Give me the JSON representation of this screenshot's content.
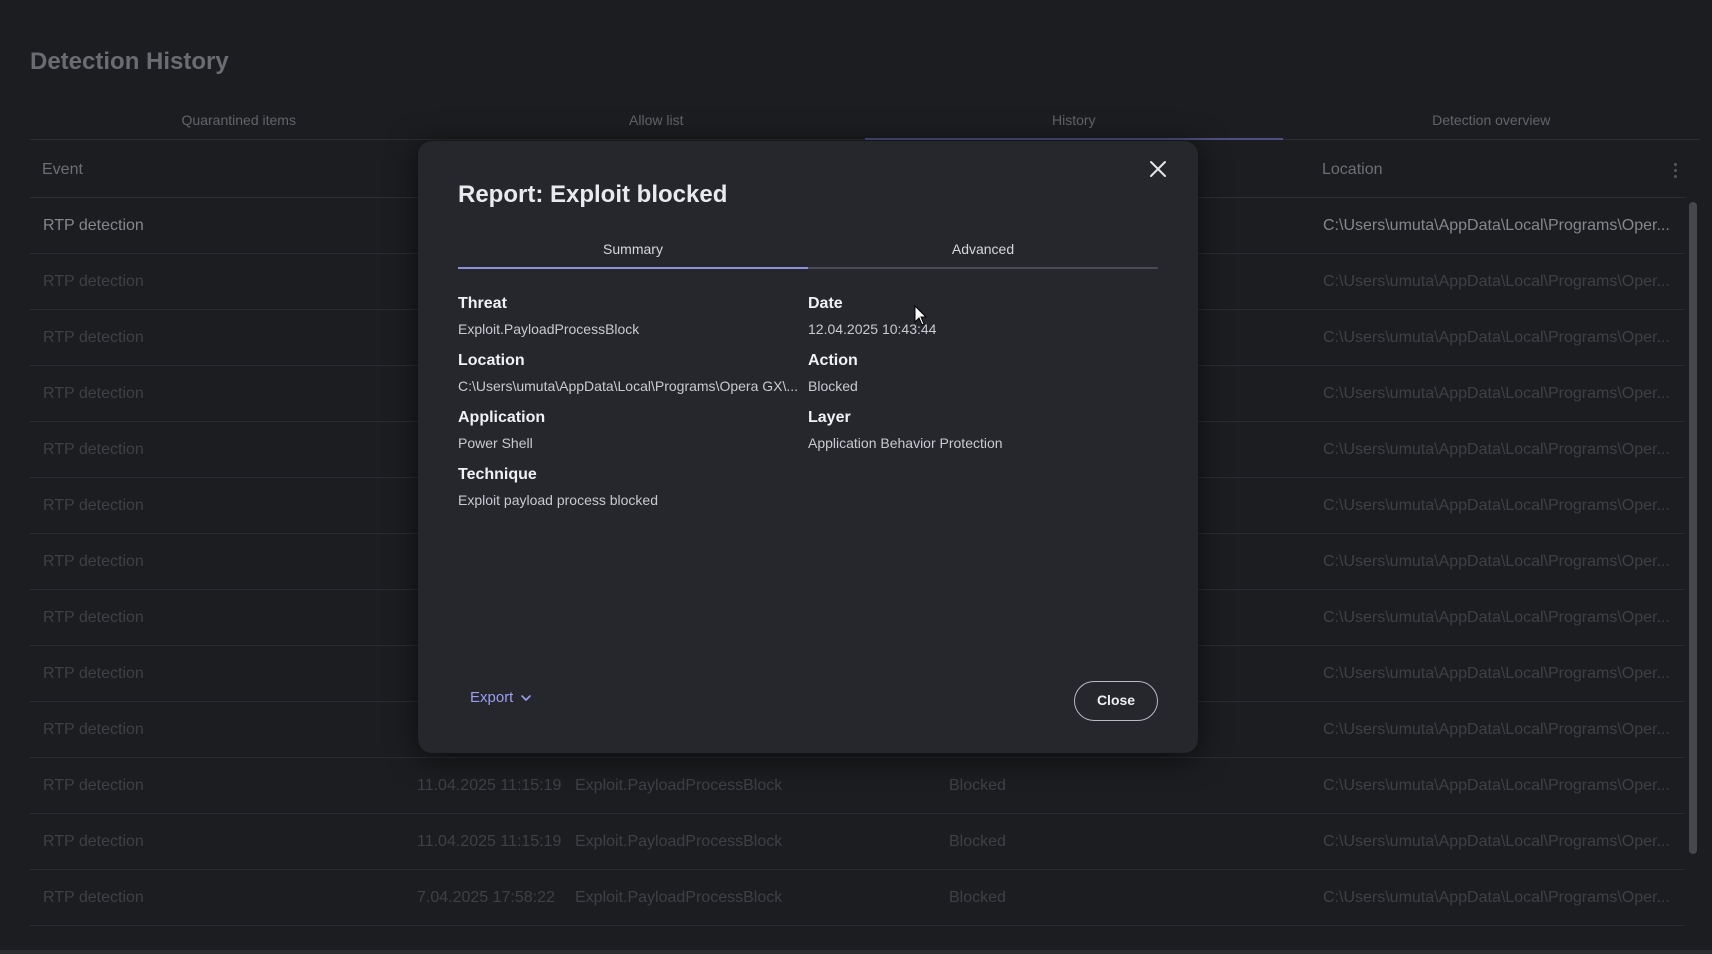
{
  "page": {
    "title": "Detection History",
    "tabs": [
      "Quarantined items",
      "Allow list",
      "History",
      "Detection overview"
    ],
    "active_tab": 2
  },
  "table": {
    "columns": {
      "event": "Event",
      "location": "Location"
    },
    "rows": [
      {
        "event": "RTP detection",
        "date": "",
        "threat": "",
        "action": "",
        "location": "C:\\Users\\umuta\\AppData\\Local\\Programs\\Oper..."
      },
      {
        "event": "RTP detection",
        "date": "",
        "threat": "",
        "action": "",
        "location": "C:\\Users\\umuta\\AppData\\Local\\Programs\\Oper..."
      },
      {
        "event": "RTP detection",
        "date": "",
        "threat": "",
        "action": "",
        "location": "C:\\Users\\umuta\\AppData\\Local\\Programs\\Oper..."
      },
      {
        "event": "RTP detection",
        "date": "",
        "threat": "",
        "action": "",
        "location": "C:\\Users\\umuta\\AppData\\Local\\Programs\\Oper..."
      },
      {
        "event": "RTP detection",
        "date": "",
        "threat": "",
        "action": "",
        "location": "C:\\Users\\umuta\\AppData\\Local\\Programs\\Oper..."
      },
      {
        "event": "RTP detection",
        "date": "",
        "threat": "",
        "action": "",
        "location": "C:\\Users\\umuta\\AppData\\Local\\Programs\\Oper..."
      },
      {
        "event": "RTP detection",
        "date": "",
        "threat": "",
        "action": "",
        "location": "C:\\Users\\umuta\\AppData\\Local\\Programs\\Oper..."
      },
      {
        "event": "RTP detection",
        "date": "",
        "threat": "",
        "action": "",
        "location": "C:\\Users\\umuta\\AppData\\Local\\Programs\\Oper..."
      },
      {
        "event": "RTP detection",
        "date": "",
        "threat": "",
        "action": "",
        "location": "C:\\Users\\umuta\\AppData\\Local\\Programs\\Oper..."
      },
      {
        "event": "RTP detection",
        "date": "",
        "threat": "",
        "action": "",
        "location": "C:\\Users\\umuta\\AppData\\Local\\Programs\\Oper..."
      },
      {
        "event": "RTP detection",
        "date": "11.04.2025 11:15:19",
        "threat": "Exploit.PayloadProcessBlock",
        "action": "Blocked",
        "location": "C:\\Users\\umuta\\AppData\\Local\\Programs\\Oper..."
      },
      {
        "event": "RTP detection",
        "date": "11.04.2025 11:15:19",
        "threat": "Exploit.PayloadProcessBlock",
        "action": "Blocked",
        "location": "C:\\Users\\umuta\\AppData\\Local\\Programs\\Oper..."
      },
      {
        "event": "RTP detection",
        "date": "7.04.2025 17:58:22",
        "threat": "Exploit.PayloadProcessBlock",
        "action": "Blocked",
        "location": "C:\\Users\\umuta\\AppData\\Local\\Programs\\Oper..."
      }
    ]
  },
  "modal": {
    "title": "Report: Exploit blocked",
    "tabs": [
      "Summary",
      "Advanced"
    ],
    "active_tab": 0,
    "fields": {
      "threat": {
        "label": "Threat",
        "value": "Exploit.PayloadProcessBlock"
      },
      "date": {
        "label": "Date",
        "value": "12.04.2025 10:43:44"
      },
      "location": {
        "label": "Location",
        "value": "C:\\Users\\umuta\\AppData\\Local\\Programs\\Opera GX\\..."
      },
      "action": {
        "label": "Action",
        "value": "Blocked"
      },
      "application": {
        "label": "Application",
        "value": "Power Shell"
      },
      "layer": {
        "label": "Layer",
        "value": "Application Behavior Protection"
      },
      "technique": {
        "label": "Technique",
        "value": "Exploit payload process blocked"
      }
    },
    "export_label": "Export",
    "close_label": "Close"
  },
  "colors": {
    "accent": "#8c90d8",
    "modal_bg": "#25272d",
    "page_bg": "#1c1d20"
  },
  "icons": [
    "close-icon",
    "chevron-down-icon",
    "more-vertical-icon",
    "mouse-cursor-icon"
  ]
}
